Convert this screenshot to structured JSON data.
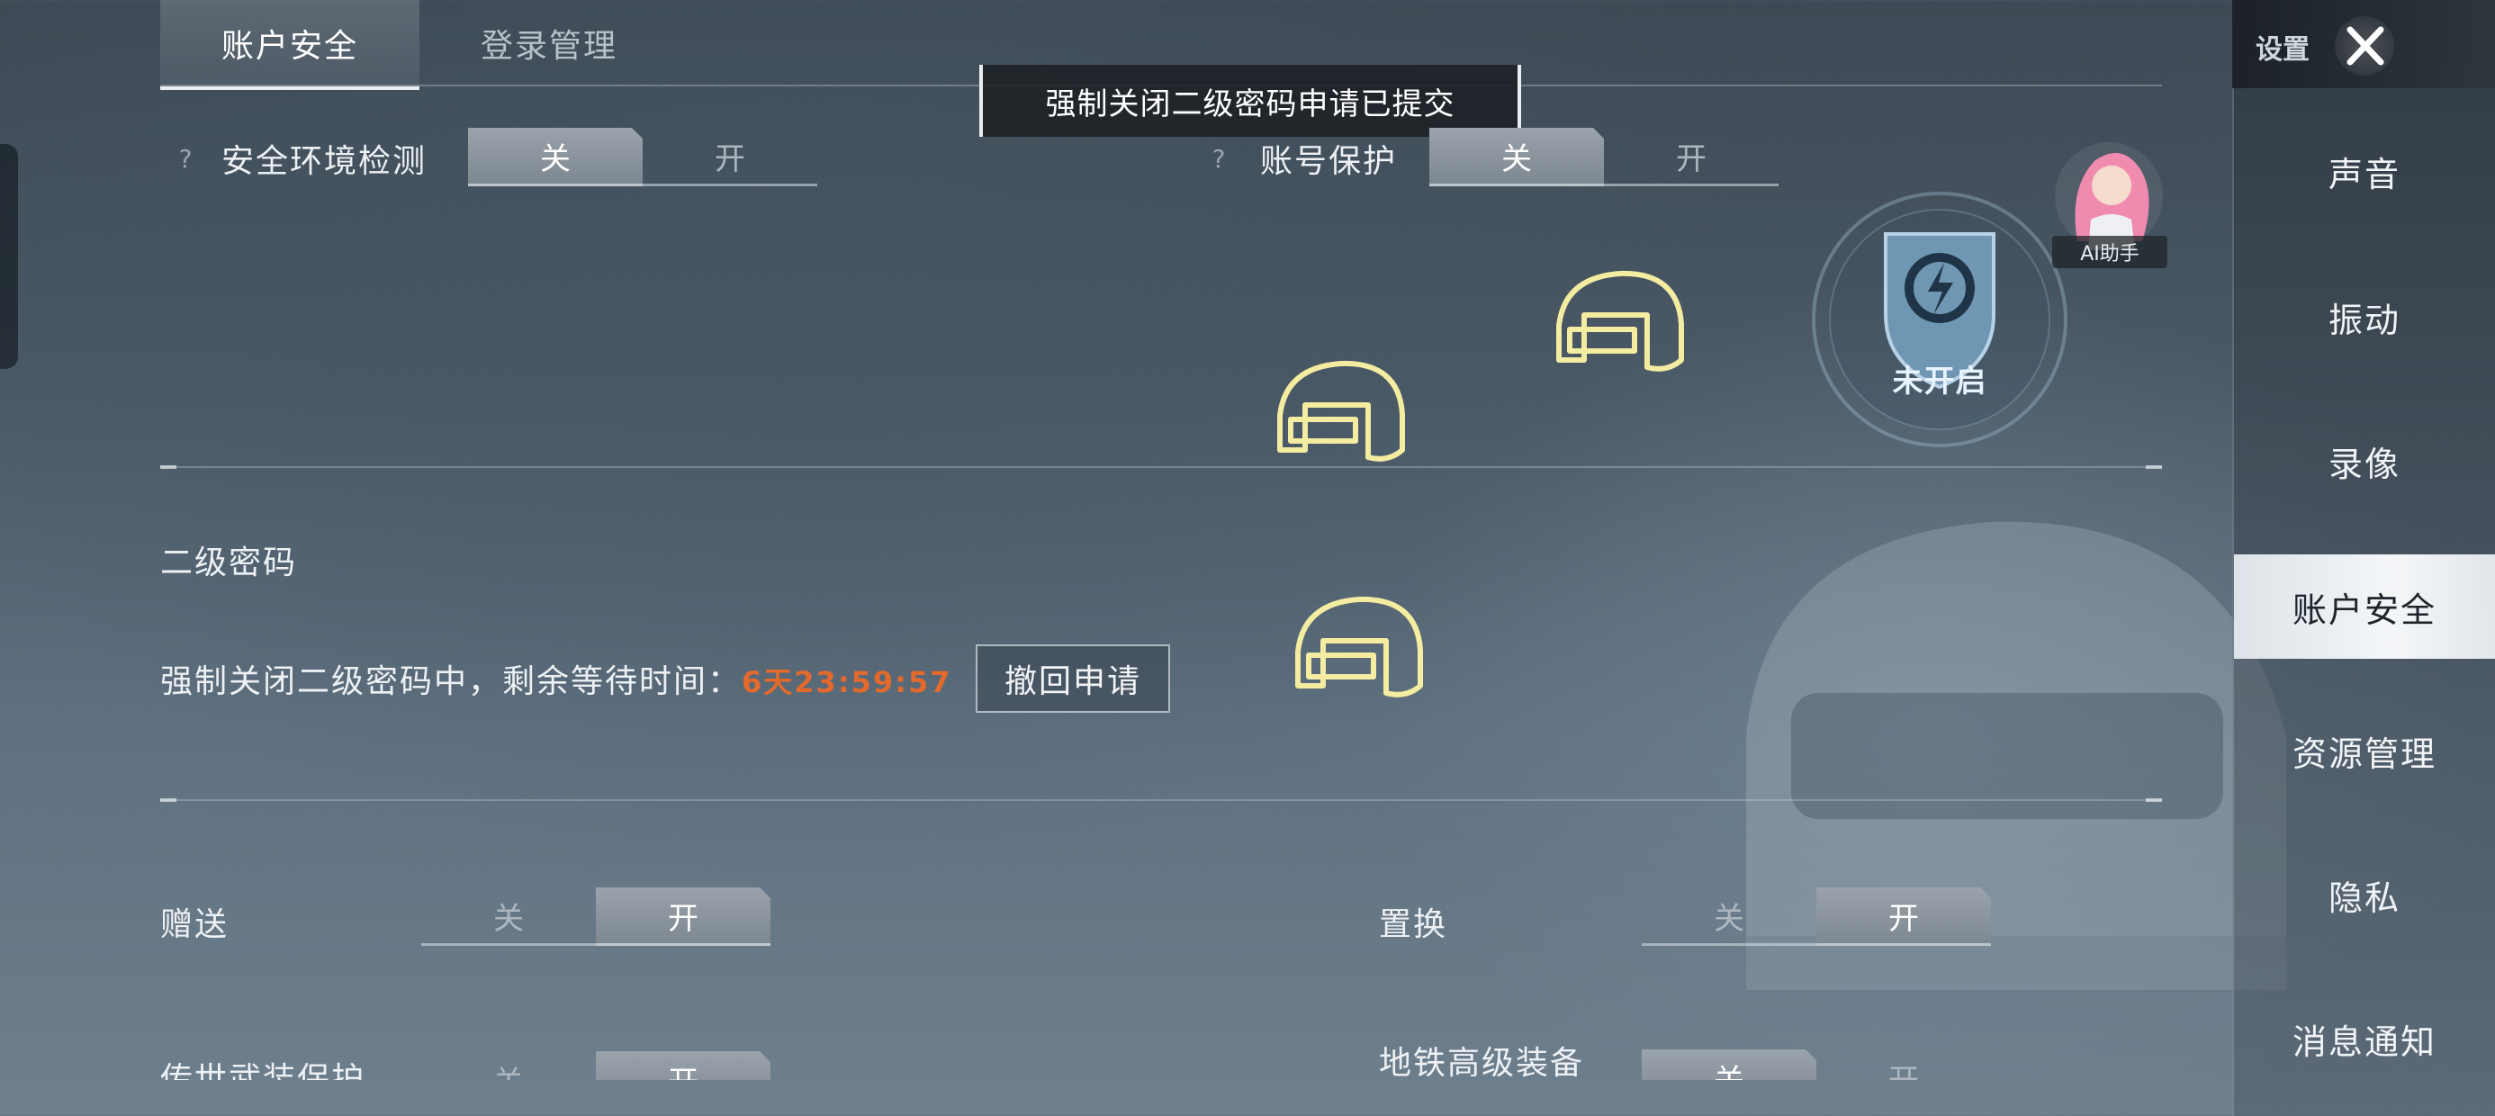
{
  "tabs": [
    {
      "label": "账户安全",
      "active": true
    },
    {
      "label": "登录管理",
      "active": false
    }
  ],
  "toast": {
    "message": "强制关闭二级密码申请已提交"
  },
  "security_env": {
    "help": "?",
    "label": "安全环境检测",
    "off": "关",
    "on": "开",
    "value": "关"
  },
  "account_protect": {
    "help": "?",
    "label": "账号保护",
    "off": "关",
    "on": "开",
    "value": "关"
  },
  "shield_badge": {
    "status": "未开启"
  },
  "ai_assistant": {
    "label": "AI助手"
  },
  "secondary_password": {
    "title": "二级密码",
    "status_text": "强制关闭二级密码中，剩余等待时间：",
    "countdown": "6天23:59:57",
    "withdraw_button": "撤回申请"
  },
  "gift": {
    "label": "赠送",
    "off": "关",
    "on": "开",
    "value": "开"
  },
  "replace": {
    "label": "置换",
    "off": "关",
    "on": "开",
    "value": "开"
  },
  "legend_protect": {
    "label": "传世武装保护",
    "off": "关",
    "on": "开",
    "value": "开"
  },
  "metro_gear": {
    "label": "地铁高级装备",
    "off": "关",
    "on": "开",
    "value": "关"
  },
  "sidebar": {
    "title": "设置",
    "items": [
      {
        "label": "声音",
        "active": false
      },
      {
        "label": "振动",
        "active": false
      },
      {
        "label": "录像",
        "active": false
      },
      {
        "label": "账户安全",
        "active": true
      },
      {
        "label": "资源管理",
        "active": false
      },
      {
        "label": "隐私",
        "active": false
      },
      {
        "label": "消息通知",
        "active": false
      }
    ]
  },
  "colors": {
    "countdown": "#e36a2c",
    "accent": "#e9edf0",
    "helmet_glow": "#f4eca0"
  }
}
